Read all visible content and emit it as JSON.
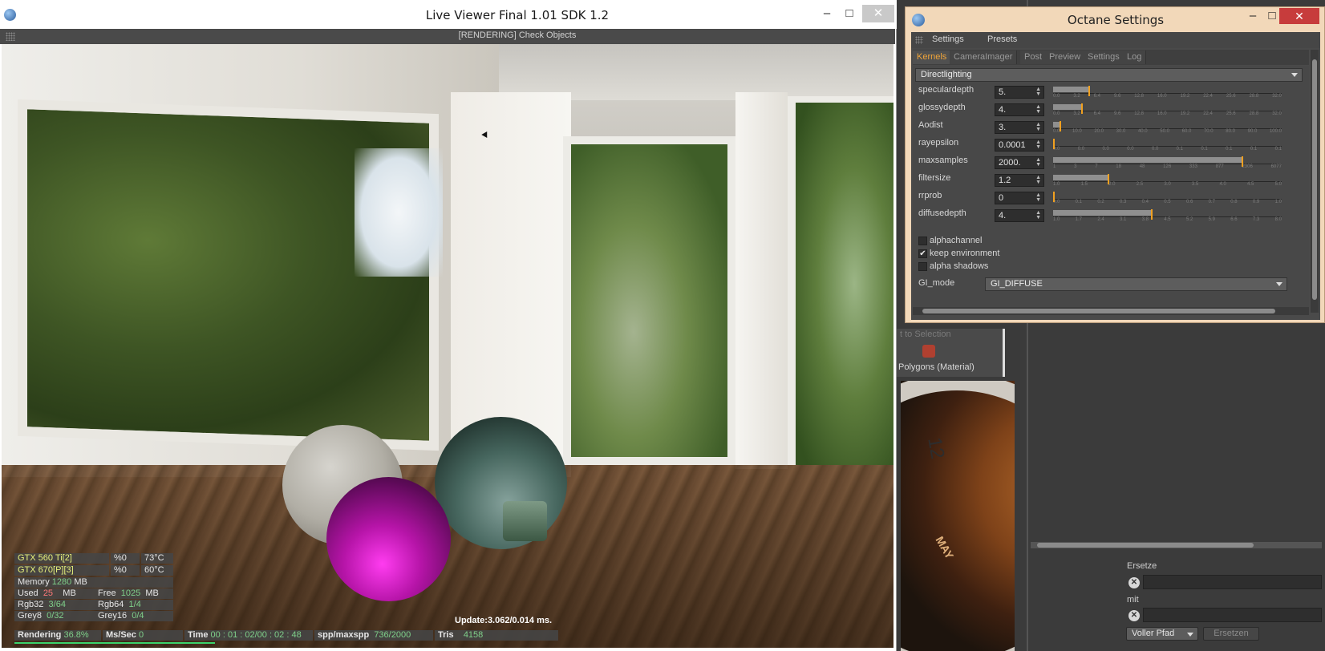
{
  "live_viewer": {
    "title": "Live Viewer Final 1.01   SDK 1.2",
    "status": "[RENDERING] Check Objects",
    "window_controls": {
      "minimize": "–",
      "maximize": "□",
      "close": "✕"
    },
    "hud": {
      "gpu1_name": "GTX 560 Ti[2]",
      "gpu1_load": "%0",
      "gpu1_temp": "73°C",
      "gpu2_name": "GTX 670[P][3]",
      "gpu2_load": "%0",
      "gpu2_temp": "60°C",
      "memory_label": "Memory",
      "memory_value": "1280",
      "memory_unit": "MB",
      "used_label": "Used",
      "used_value": "25",
      "used_unit": "MB",
      "free_label": "Free",
      "free_value": "1025",
      "free_unit": "MB",
      "rgb32_label": "Rgb32",
      "rgb32_value": "3/64",
      "rgb64_label": "Rgb64",
      "rgb64_value": "1/4",
      "grey8_label": "Grey8",
      "grey8_value": "0/32",
      "grey16_label": "Grey16",
      "grey16_value": "0/4",
      "update": "Update:3.062/0.014 ms.",
      "rendering_label": "Rendering",
      "rendering_value": "36.8%",
      "mssec_label": "Ms/Sec",
      "mssec_value": "0",
      "time_label": "Time",
      "time_value": "00 : 01 : 02/00 : 02 : 48",
      "spp_label": "spp/maxspp",
      "spp_value": "736/2000",
      "tris_label": "Tris",
      "tris_value": "4158",
      "progress_fraction": 0.368
    }
  },
  "background_app": {
    "selection_hint": "t to Selection",
    "polygons_label": "Polygons (Material)",
    "ersetze_label": "Ersetze",
    "mit_label": "mit",
    "clear_icon": "✕",
    "voller_pfad": "Voller Pfad",
    "ersetzen_button": "Ersetzen",
    "watch_number": "12",
    "watch_month": "MAY"
  },
  "octane": {
    "title": "Octane Settings",
    "window_controls": {
      "minimize": "–",
      "maximize": "□",
      "close": "✕"
    },
    "menu": [
      "Settings",
      "Presets"
    ],
    "tabs": [
      "Kernels",
      "CameraImager",
      "Post",
      "Preview",
      "Settings",
      "Log"
    ],
    "active_tab": "Kernels",
    "kernel": "Directlighting",
    "params": [
      {
        "label": "speculardepth",
        "value": "5.",
        "level": 0.155,
        "ticks": [
          "0.0",
          "3.2",
          "6.4",
          "9.6",
          "12.8",
          "16.0",
          "19.2",
          "22.4",
          "25.6",
          "28.8",
          "32.0"
        ]
      },
      {
        "label": "glossydepth",
        "value": "4.",
        "level": 0.125,
        "ticks": [
          "0.0",
          "3.2",
          "6.4",
          "9.6",
          "12.8",
          "16.0",
          "19.2",
          "22.4",
          "25.6",
          "28.8",
          "32.0"
        ]
      },
      {
        "label": "Aodist",
        "value": "3.",
        "level": 0.03,
        "ticks": [
          "0.0",
          "10.0",
          "20.0",
          "30.0",
          "40.0",
          "50.0",
          "60.0",
          "70.0",
          "80.0",
          "90.0",
          "100.0"
        ]
      },
      {
        "label": "rayepsilon",
        "value": "0.0001",
        "level": 0.0,
        "ticks": [
          "0.0",
          "0.0",
          "0.0",
          "0.0",
          "0.0",
          "0.1",
          "0.1",
          "0.1",
          "0.1",
          "0.1"
        ]
      },
      {
        "label": "maxsamples",
        "value": "2000.",
        "level": 0.83,
        "ticks": [
          "1",
          "3",
          "7",
          "18",
          "48",
          "126",
          "333",
          "877",
          "2306",
          "6077"
        ]
      },
      {
        "label": "filtersize",
        "value": "1.2",
        "level": 0.24,
        "ticks": [
          "1.0",
          "1.5",
          "2.0",
          "2.5",
          "3.0",
          "3.5",
          "4.0",
          "4.5",
          "5.0"
        ]
      },
      {
        "label": "rrprob",
        "value": "0",
        "level": 0.0,
        "ticks": [
          "0.0",
          "0.1",
          "0.2",
          "0.3",
          "0.4",
          "0.5",
          "0.6",
          "0.7",
          "0.8",
          "0.9",
          "1.0"
        ]
      },
      {
        "label": "diffusedepth",
        "value": "4.",
        "level": 0.43,
        "ticks": [
          "1.0",
          "1.7",
          "2.4",
          "3.1",
          "3.8",
          "4.5",
          "5.2",
          "5.9",
          "6.6",
          "7.3",
          "8.0"
        ]
      }
    ],
    "checkboxes": [
      {
        "label": "alphachannel",
        "checked": false
      },
      {
        "label": "keep environment",
        "checked": true
      },
      {
        "label": "alpha shadows",
        "checked": false
      }
    ],
    "gi_mode_label": "GI_mode",
    "gi_mode_value": "GI_DIFFUSE",
    "accent_color": "#f0a53a",
    "slider_knob_color": "#f0a020"
  }
}
